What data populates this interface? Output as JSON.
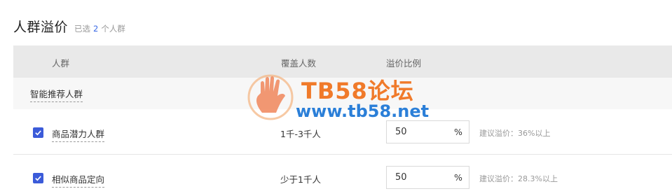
{
  "header": {
    "title": "人群溢价",
    "selected_prefix": "已选",
    "selected_count": "2",
    "selected_suffix": "个人群"
  },
  "table": {
    "columns": {
      "group": "人群",
      "coverage": "覆盖人数",
      "premium": "溢价比例"
    },
    "group_label": "智能推荐人群",
    "rows": [
      {
        "checked": true,
        "name": "商品潜力人群",
        "coverage": "1千-3千人",
        "premium_value": "50",
        "unit": "%",
        "suggestion": "建议溢价：36%以上"
      },
      {
        "checked": true,
        "name": "相似商品定向",
        "coverage": "少于1千人",
        "premium_value": "50",
        "unit": "%",
        "suggestion": "建议溢价：28.3%以上"
      }
    ]
  },
  "watermark": {
    "title": "TB58论坛",
    "url": "www.tb58.net"
  },
  "colors": {
    "accent": "#3b5bd9",
    "count": "#3b6ae6",
    "header_bg": "#e9e9e9",
    "watermark_orange": "#f07a2a",
    "watermark_blue": "#2b7fd8"
  }
}
